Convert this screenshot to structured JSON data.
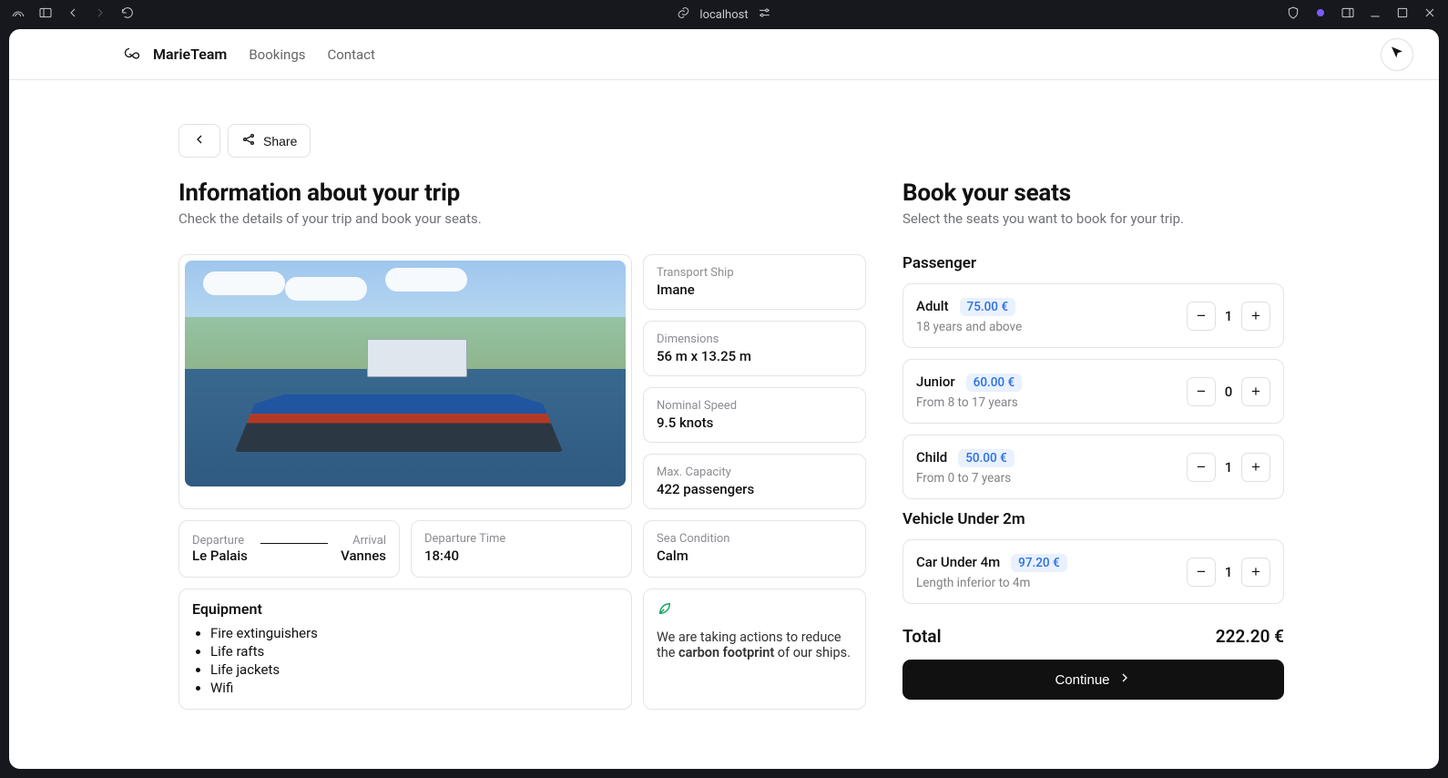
{
  "chrome": {
    "host": "localhost"
  },
  "brand": {
    "name": "MarieTeam"
  },
  "nav": {
    "bookings": "Bookings",
    "contact": "Contact"
  },
  "actions": {
    "share": "Share"
  },
  "info_section": {
    "title": "Information about your trip",
    "subtitle": "Check the details of your trip and book your seats."
  },
  "ship": {
    "transport_ship_lbl": "Transport Ship",
    "transport_ship_val": "Imane",
    "dimensions_lbl": "Dimensions",
    "dimensions_val": "56 m x 13.25 m",
    "speed_lbl": "Nominal Speed",
    "speed_val": "9.5 knots",
    "capacity_lbl": "Max. Capacity",
    "capacity_val": "422 passengers"
  },
  "route": {
    "departure_lbl": "Departure",
    "departure_val": "Le Palais",
    "arrival_lbl": "Arrival",
    "arrival_val": "Vannes",
    "dep_time_lbl": "Departure Time",
    "dep_time_val": "18:40",
    "sea_lbl": "Sea Condition",
    "sea_val": "Calm"
  },
  "equipment": {
    "title": "Equipment",
    "items": [
      "Fire extinguishers",
      "Life rafts",
      "Life jackets",
      "Wifi"
    ]
  },
  "eco": {
    "text_pre": "We are taking actions to reduce the ",
    "text_bold": "carbon footprint",
    "text_post": " of our ships."
  },
  "booking": {
    "title": "Book your seats",
    "subtitle": "Select the seats you want to book for your trip.",
    "groups": [
      {
        "heading": "Passenger",
        "rows": [
          {
            "name": "Adult",
            "price": "75.00 €",
            "desc": "18 years and above",
            "qty": "1"
          },
          {
            "name": "Junior",
            "price": "60.00 €",
            "desc": "From 8 to 17 years",
            "qty": "0"
          },
          {
            "name": "Child",
            "price": "50.00 €",
            "desc": "From 0 to 7 years",
            "qty": "1"
          }
        ]
      },
      {
        "heading": "Vehicle Under 2m",
        "rows": [
          {
            "name": "Car Under 4m",
            "price": "97.20 €",
            "desc": "Length inferior to 4m",
            "qty": "1"
          }
        ]
      }
    ],
    "total_label": "Total",
    "total_value": "222.20 €",
    "continue": "Continue"
  }
}
